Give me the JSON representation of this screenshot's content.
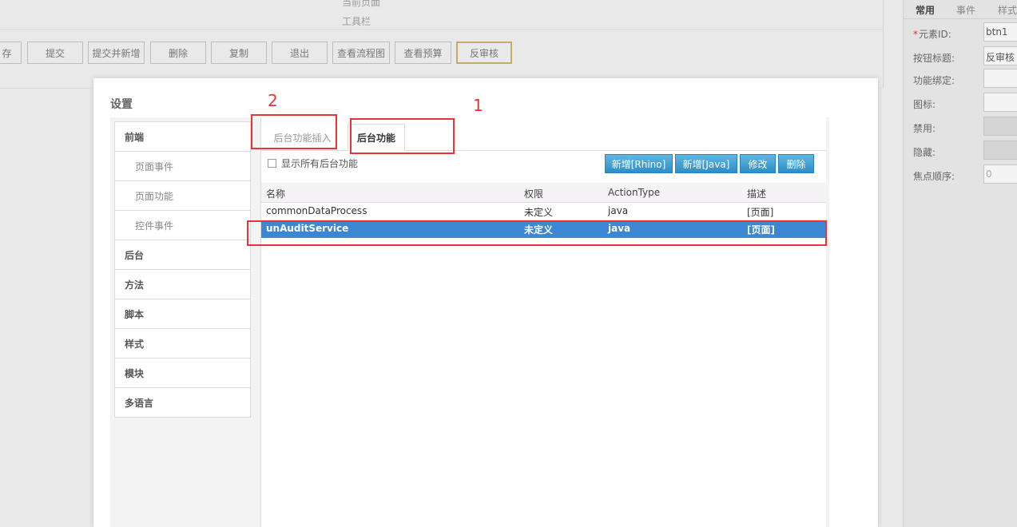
{
  "background": {
    "current_page_label": "当前页面",
    "toolbar_label": "工具栏",
    "toolbar_buttons": [
      "存",
      "提交",
      "提交并新增",
      "删除",
      "复制",
      "退出",
      "查看流程图",
      "查看预算",
      "反审核"
    ]
  },
  "properties": {
    "tabs": [
      "常用",
      "事件",
      "样式"
    ],
    "rows": [
      {
        "label": "元素ID:",
        "value": "btn1",
        "required": true
      },
      {
        "label": "按钮标题:",
        "value": "反审核"
      },
      {
        "label": "功能绑定:",
        "value": ""
      },
      {
        "label": "图标:",
        "value": ""
      },
      {
        "label": "禁用:",
        "value": ""
      },
      {
        "label": "隐藏:",
        "value": ""
      },
      {
        "label": "焦点顺序:",
        "value": "0"
      }
    ]
  },
  "dialog": {
    "title": "设置",
    "nav": [
      {
        "label": "前端",
        "kind": "group"
      },
      {
        "label": "页面事件",
        "kind": "sub"
      },
      {
        "label": "页面功能",
        "kind": "sub"
      },
      {
        "label": "控件事件",
        "kind": "sub"
      },
      {
        "label": "后台",
        "kind": "group"
      },
      {
        "label": "方法",
        "kind": "group"
      },
      {
        "label": "脚本",
        "kind": "group"
      },
      {
        "label": "样式",
        "kind": "group"
      },
      {
        "label": "模块",
        "kind": "group"
      },
      {
        "label": "多语言",
        "kind": "group"
      }
    ],
    "tabs": [
      "后台功能插入",
      "后台功能"
    ],
    "show_all_label": "显示所有后台功能",
    "buttons": [
      "新增[Rhino]",
      "新增[Java]",
      "修改",
      "删除"
    ],
    "table": {
      "columns": [
        "名称",
        "权限",
        "ActionType",
        "描述"
      ],
      "rows": [
        [
          "commonDataProcess",
          "未定义",
          "java",
          "[页面]"
        ],
        [
          "unAuditService",
          "未定义",
          "java",
          "[页面]"
        ]
      ]
    },
    "annotations": [
      "2",
      "1"
    ]
  },
  "colors": {
    "annotation": "#e6353a",
    "selection": "#3c87d4",
    "action_button": "#2b8ec7"
  }
}
